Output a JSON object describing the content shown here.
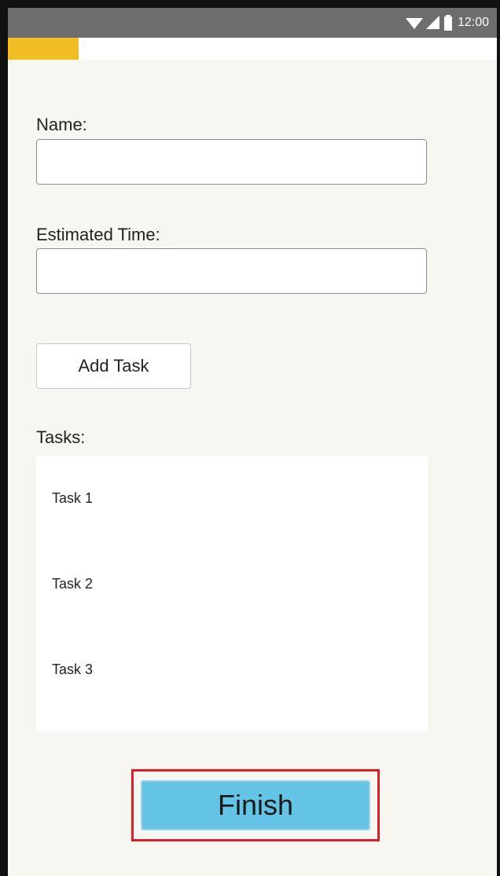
{
  "status_bar": {
    "time": "12:00",
    "icons": [
      "wifi-icon",
      "signal-icon",
      "battery-icon"
    ]
  },
  "colors": {
    "accent": "#f2bd22",
    "finish_button": "#63c4e5",
    "highlight": "#e11d2a",
    "status_bar": "#6e6e6e",
    "background": "#f8f6f1"
  },
  "form": {
    "name_label": "Name:",
    "name_value": "",
    "estimated_time_label": "Estimated Time:",
    "estimated_time_value": "",
    "add_task_label": "Add Task"
  },
  "tasks": {
    "label": "Tasks:",
    "items": [
      "Task 1",
      "Task 2",
      "Task 3"
    ]
  },
  "finish": {
    "label": "Finish"
  }
}
